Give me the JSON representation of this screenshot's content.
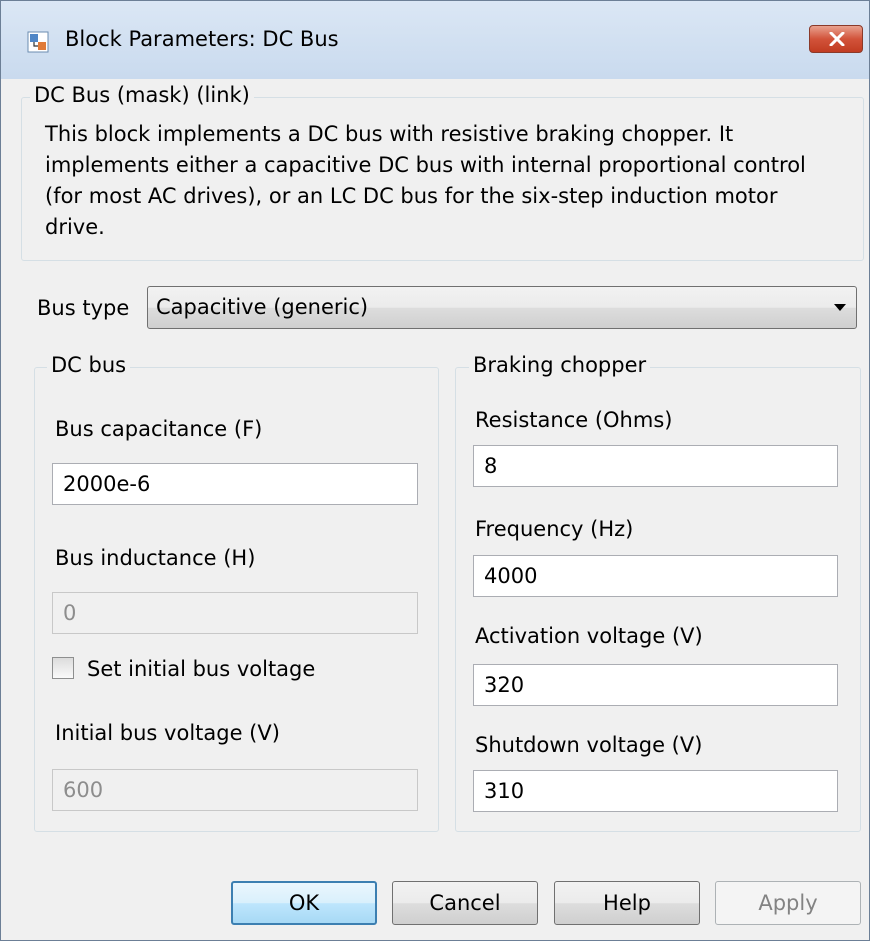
{
  "window": {
    "title": "Block Parameters: DC Bus"
  },
  "mask": {
    "legend": "DC Bus (mask) (link)",
    "description": "This block implements a DC bus with resistive braking chopper. It implements either a capacitive DC bus with internal proportional control (for most AC drives), or an LC DC bus for the six-step induction motor drive."
  },
  "bus_type": {
    "label": "Bus type",
    "value": "Capacitive (generic)"
  },
  "dc_bus": {
    "legend": "DC bus",
    "capacitance_label": "Bus capacitance (F)",
    "capacitance_value": "2000e-6",
    "inductance_label": "Bus inductance (H)",
    "inductance_value": "0",
    "set_initial_label": "Set initial bus voltage",
    "set_initial_checked": false,
    "initial_voltage_label": "Initial bus voltage (V)",
    "initial_voltage_value": "600"
  },
  "chopper": {
    "legend": "Braking chopper",
    "resistance_label": "Resistance (Ohms)",
    "resistance_value": "8",
    "frequency_label": "Frequency (Hz)",
    "frequency_value": "4000",
    "activation_label": "Activation voltage (V)",
    "activation_value": "320",
    "shutdown_label": "Shutdown voltage (V)",
    "shutdown_value": "310"
  },
  "buttons": {
    "ok": "OK",
    "cancel": "Cancel",
    "help": "Help",
    "apply": "Apply"
  },
  "icons": {
    "title": "simulink-block-icon",
    "close": "close-icon",
    "dropdown": "chevron-down-icon"
  },
  "colors": {
    "titlebar": "#c9daee",
    "close": "#c13c22",
    "default_button": "#3c7fb1"
  }
}
